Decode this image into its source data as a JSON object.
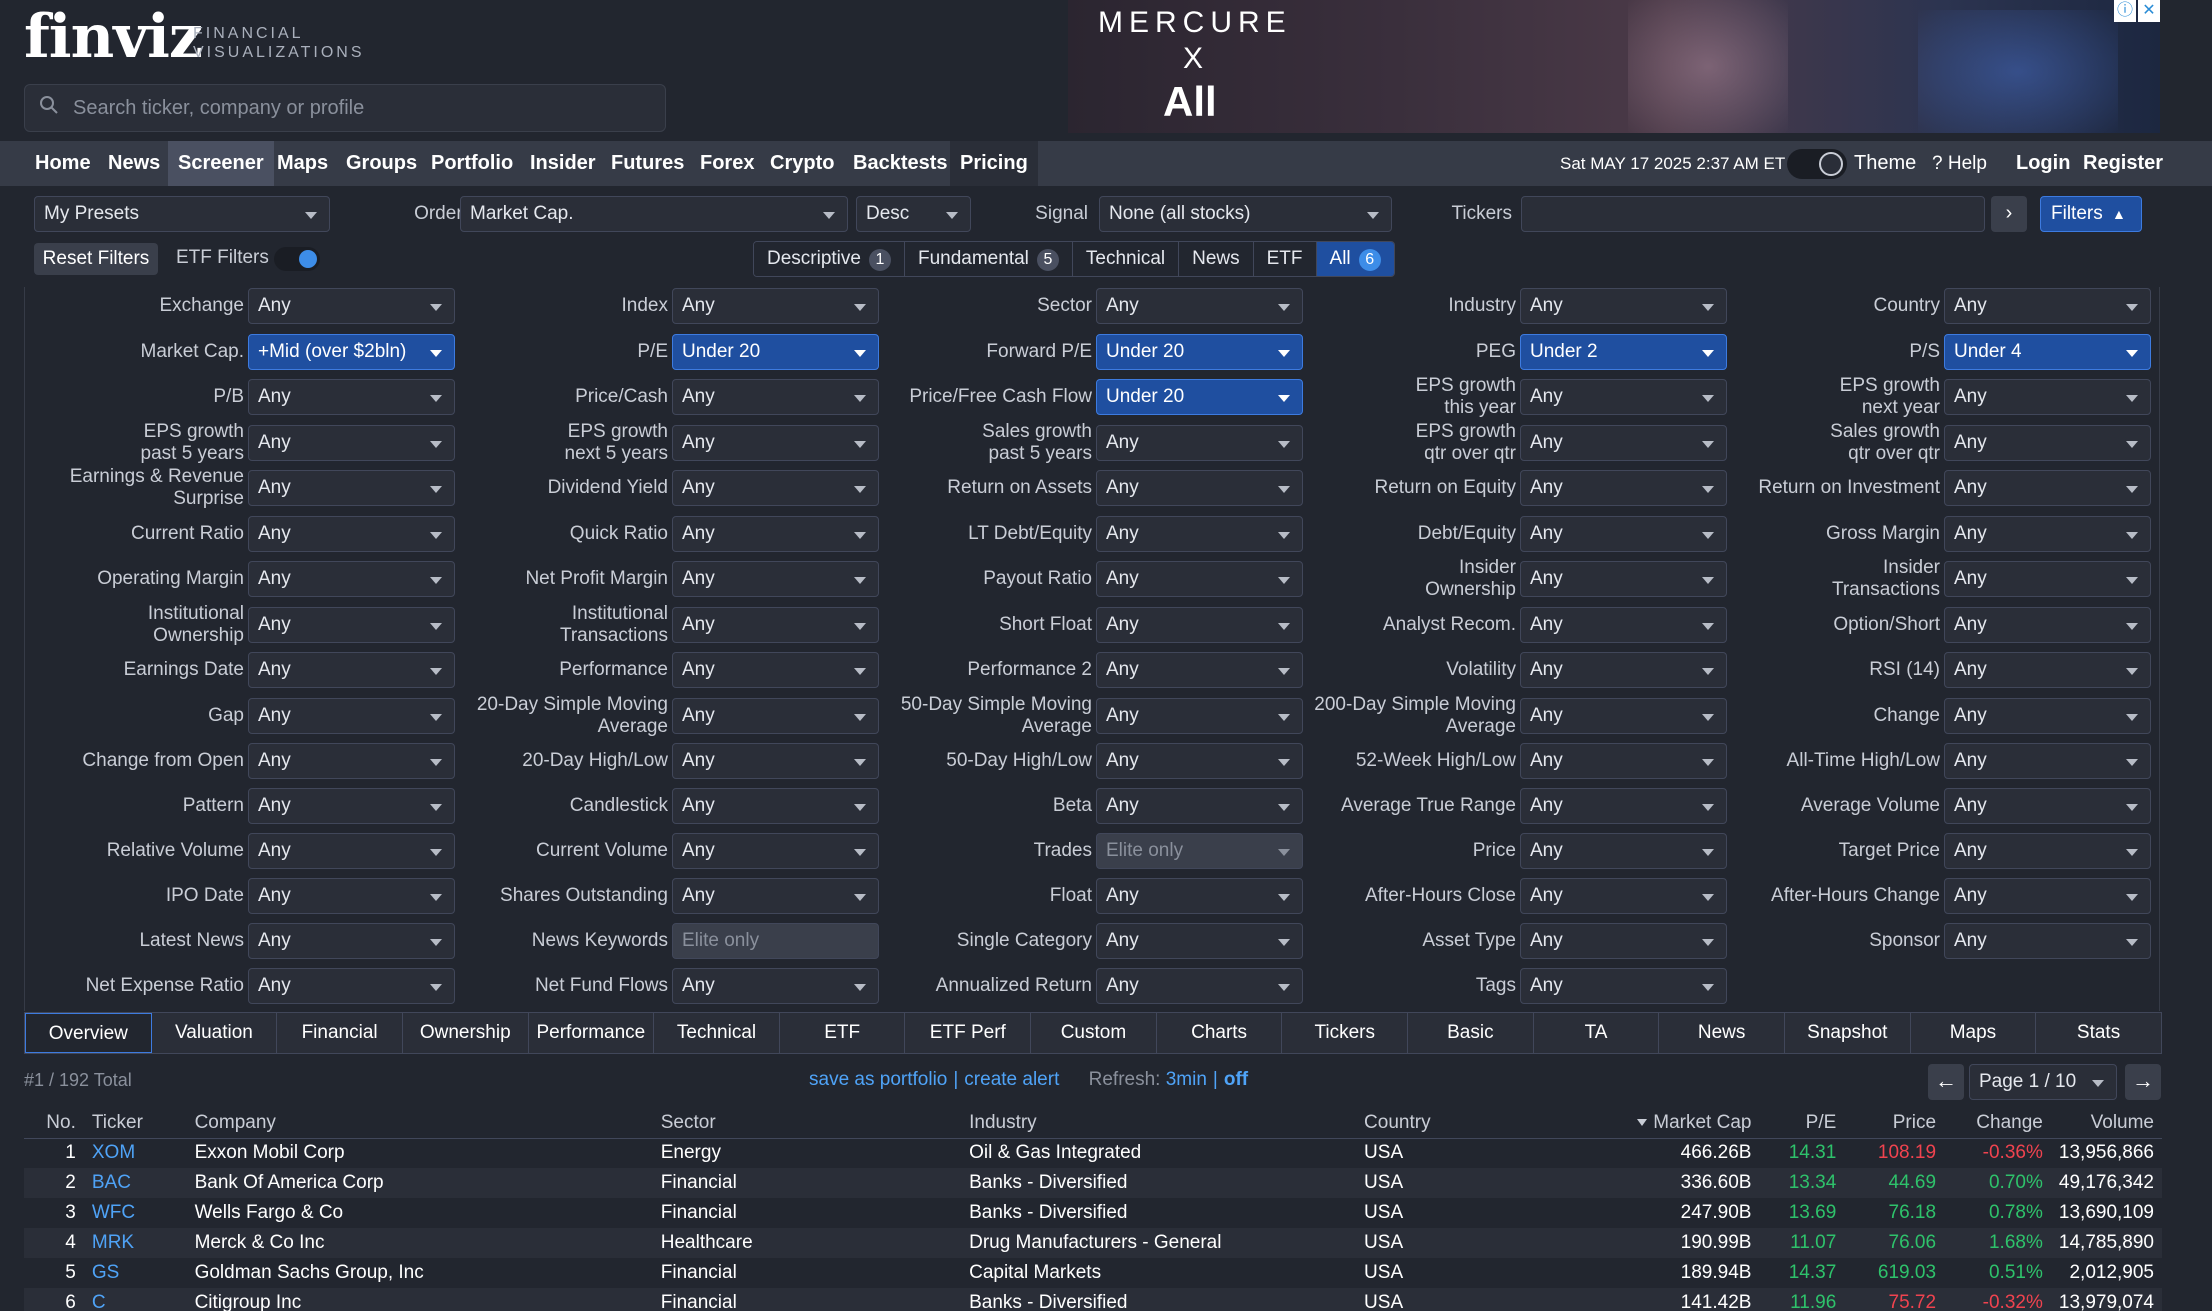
{
  "logo": {
    "word": "finviz",
    "subtitle_line1": "FINANCIAL",
    "subtitle_line2": "VISUALIZATIONS"
  },
  "search": {
    "placeholder": "Search ticker, company or profile"
  },
  "ad": {
    "brand": "MERCURE",
    "x": "X",
    "partner": "All",
    "info_icon": "info-icon",
    "close_icon": "close-icon"
  },
  "nav": {
    "items": [
      "Home",
      "News",
      "Screener",
      "Maps",
      "Groups",
      "Portfolio",
      "Insider",
      "Futures",
      "Forex",
      "Crypto",
      "Backtests",
      "Pricing"
    ],
    "active": "Screener",
    "datetime": "Sat MAY 17 2025 2:37 AM ET",
    "theme": "Theme",
    "help": "Help",
    "login": "Login",
    "register": "Register"
  },
  "controls": {
    "presets": "My Presets",
    "order_by_label": "Order by",
    "order_by": "Market Cap.",
    "order_dir": "Desc",
    "signal_label": "Signal",
    "signal": "None (all stocks)",
    "tickers_label": "Tickers",
    "tickers_value": "",
    "filters_btn": "Filters",
    "reset": "Reset Filters",
    "etf_filters": "ETF Filters"
  },
  "filter_tabs": [
    {
      "label": "Descriptive",
      "count": "1"
    },
    {
      "label": "Fundamental",
      "count": "5"
    },
    {
      "label": "Technical",
      "count": ""
    },
    {
      "label": "News",
      "count": ""
    },
    {
      "label": "ETF",
      "count": ""
    },
    {
      "label": "All",
      "count": "6",
      "active": true
    }
  ],
  "filters": [
    [
      "Exchange",
      "Any"
    ],
    [
      "Index",
      "Any"
    ],
    [
      "Sector",
      "Any"
    ],
    [
      "Industry",
      "Any"
    ],
    [
      "Country",
      "Any"
    ],
    [
      "Market Cap.",
      "+Mid (over $2bln)",
      "active"
    ],
    [
      "P/E",
      "Under 20",
      "active"
    ],
    [
      "Forward P/E",
      "Under 20",
      "active"
    ],
    [
      "PEG",
      "Under 2",
      "active"
    ],
    [
      "P/S",
      "Under 4",
      "active"
    ],
    [
      "P/B",
      "Any"
    ],
    [
      "Price/Cash",
      "Any"
    ],
    [
      "Price/Free Cash Flow",
      "Under 20",
      "active"
    ],
    [
      "EPS growth\nthis year",
      "Any"
    ],
    [
      "EPS growth\nnext year",
      "Any"
    ],
    [
      "EPS growth\npast 5 years",
      "Any"
    ],
    [
      "EPS growth\nnext 5 years",
      "Any"
    ],
    [
      "Sales growth\npast 5 years",
      "Any"
    ],
    [
      "EPS growth\nqtr over qtr",
      "Any"
    ],
    [
      "Sales growth\nqtr over qtr",
      "Any"
    ],
    [
      "Earnings & Revenue\nSurprise",
      "Any"
    ],
    [
      "Dividend Yield",
      "Any"
    ],
    [
      "Return on Assets",
      "Any"
    ],
    [
      "Return on Equity",
      "Any"
    ],
    [
      "Return on Investment",
      "Any"
    ],
    [
      "Current Ratio",
      "Any"
    ],
    [
      "Quick Ratio",
      "Any"
    ],
    [
      "LT Debt/Equity",
      "Any"
    ],
    [
      "Debt/Equity",
      "Any"
    ],
    [
      "Gross Margin",
      "Any"
    ],
    [
      "Operating Margin",
      "Any"
    ],
    [
      "Net Profit Margin",
      "Any"
    ],
    [
      "Payout Ratio",
      "Any"
    ],
    [
      "Insider\nOwnership",
      "Any"
    ],
    [
      "Insider\nTransactions",
      "Any"
    ],
    [
      "Institutional\nOwnership",
      "Any"
    ],
    [
      "Institutional\nTransactions",
      "Any"
    ],
    [
      "Short Float",
      "Any"
    ],
    [
      "Analyst Recom.",
      "Any"
    ],
    [
      "Option/Short",
      "Any"
    ],
    [
      "Earnings Date",
      "Any"
    ],
    [
      "Performance",
      "Any"
    ],
    [
      "Performance 2",
      "Any"
    ],
    [
      "Volatility",
      "Any"
    ],
    [
      "RSI (14)",
      "Any"
    ],
    [
      "Gap",
      "Any"
    ],
    [
      "20-Day Simple Moving\nAverage",
      "Any"
    ],
    [
      "50-Day Simple Moving\nAverage",
      "Any"
    ],
    [
      "200-Day Simple Moving\nAverage",
      "Any"
    ],
    [
      "Change",
      "Any"
    ],
    [
      "Change from Open",
      "Any"
    ],
    [
      "20-Day High/Low",
      "Any"
    ],
    [
      "50-Day High/Low",
      "Any"
    ],
    [
      "52-Week High/Low",
      "Any"
    ],
    [
      "All-Time High/Low",
      "Any"
    ],
    [
      "Pattern",
      "Any"
    ],
    [
      "Candlestick",
      "Any"
    ],
    [
      "Beta",
      "Any"
    ],
    [
      "Average True Range",
      "Any"
    ],
    [
      "Average Volume",
      "Any"
    ],
    [
      "Relative Volume",
      "Any"
    ],
    [
      "Current Volume",
      "Any"
    ],
    [
      "Trades",
      "Elite only",
      "disabled"
    ],
    [
      "Price",
      "Any"
    ],
    [
      "Target Price",
      "Any"
    ],
    [
      "IPO Date",
      "Any"
    ],
    [
      "Shares Outstanding",
      "Any"
    ],
    [
      "Float",
      "Any"
    ],
    [
      "After-Hours Close",
      "Any"
    ],
    [
      "After-Hours Change",
      "Any"
    ],
    [
      "Latest News",
      "Any"
    ],
    [
      "News Keywords",
      "Elite only",
      "input"
    ],
    [
      "Single Category",
      "Any"
    ],
    [
      "Asset Type",
      "Any"
    ],
    [
      "Sponsor",
      "Any"
    ],
    [
      "Net Expense Ratio",
      "Any"
    ],
    [
      "Net Fund Flows",
      "Any"
    ],
    [
      "Annualized Return",
      "Any"
    ],
    [
      "Tags",
      "Any"
    ]
  ],
  "view_tabs": [
    "Overview",
    "Valuation",
    "Financial",
    "Ownership",
    "Performance",
    "Technical",
    "ETF",
    "ETF Perf",
    "Custom",
    "Charts",
    "Tickers",
    "Basic",
    "TA",
    "News",
    "Snapshot",
    "Maps",
    "Stats"
  ],
  "results": {
    "total": "#1 / 192 Total",
    "save_portfolio": "save as portfolio",
    "create_alert": "create alert",
    "refresh_label": "Refresh:",
    "refresh_value": "3min",
    "refresh_off": "off",
    "page": "Page 1 / 10"
  },
  "table": {
    "headers": [
      "No.",
      "Ticker",
      "Company",
      "Sector",
      "Industry",
      "Country",
      "Market Cap",
      "P/E",
      "Price",
      "Change",
      "Volume"
    ],
    "rows": [
      [
        "1",
        "XOM",
        "Exxon Mobil Corp",
        "Energy",
        "Oil & Gas Integrated",
        "USA",
        "466.26B",
        "14.31",
        "108.19",
        "-0.36%",
        "13,956,866"
      ],
      [
        "2",
        "BAC",
        "Bank Of America Corp",
        "Financial",
        "Banks - Diversified",
        "USA",
        "336.60B",
        "13.34",
        "44.69",
        "0.70%",
        "49,176,342"
      ],
      [
        "3",
        "WFC",
        "Wells Fargo & Co",
        "Financial",
        "Banks - Diversified",
        "USA",
        "247.90B",
        "13.69",
        "76.18",
        "0.78%",
        "13,690,109"
      ],
      [
        "4",
        "MRK",
        "Merck & Co Inc",
        "Healthcare",
        "Drug Manufacturers - General",
        "USA",
        "190.99B",
        "11.07",
        "76.06",
        "1.68%",
        "14,785,890"
      ],
      [
        "5",
        "GS",
        "Goldman Sachs Group, Inc",
        "Financial",
        "Capital Markets",
        "USA",
        "189.94B",
        "14.37",
        "619.03",
        "0.51%",
        "2,012,905"
      ],
      [
        "6",
        "C",
        "Citigroup Inc",
        "Financial",
        "Banks - Diversified",
        "USA",
        "141.42B",
        "11.96",
        "75.72",
        "-0.32%",
        "13,979,074"
      ]
    ]
  },
  "colors": {
    "accent": "#1f4fa0",
    "link": "#4fa3f7",
    "positive": "#2ec26b",
    "negative": "#f0434f",
    "bg": "#22262f"
  }
}
